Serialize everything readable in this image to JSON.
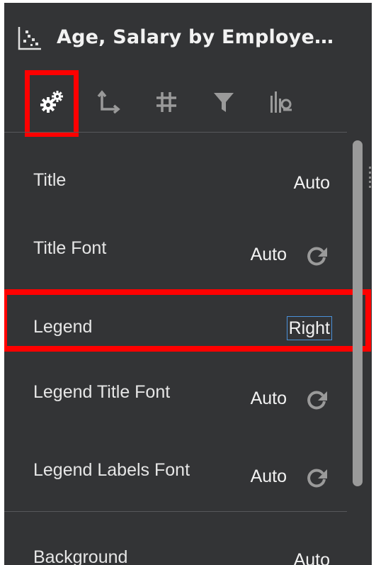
{
  "header": {
    "title": "Age, Salary by Employe…",
    "icon": "scatter-chart-icon"
  },
  "tabs": [
    {
      "id": "general",
      "icon": "gears-icon"
    },
    {
      "id": "axis",
      "icon": "axis-icon"
    },
    {
      "id": "grid",
      "icon": "hash-icon"
    },
    {
      "id": "filter",
      "icon": "filter-icon"
    },
    {
      "id": "analytics",
      "icon": "analytics-icon"
    }
  ],
  "properties": {
    "title": {
      "label": "Title",
      "value": "Auto"
    },
    "title_font": {
      "label": "Title Font",
      "value": "Auto"
    },
    "legend": {
      "label": "Legend",
      "value": "Right"
    },
    "legend_title_font": {
      "label": "Legend Title Font",
      "value": "Auto"
    },
    "legend_labels_font": {
      "label": "Legend Labels Font",
      "value": "Auto"
    },
    "background": {
      "label": "Background",
      "value": "Auto"
    }
  },
  "colors": {
    "panel_bg": "#333436",
    "highlight": "#ff0000",
    "focus": "#4a90d9"
  }
}
